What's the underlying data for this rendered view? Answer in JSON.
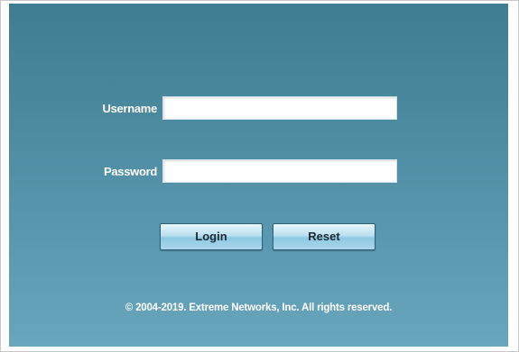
{
  "login_form": {
    "username_label": "Username",
    "username_value": "",
    "password_label": "Password",
    "password_value": "",
    "login_button": "Login",
    "reset_button": "Reset"
  },
  "footer": {
    "copyright": "© 2004-2019. Extreme Networks, Inc. All rights reserved."
  },
  "colors": {
    "panel_top": "#3f7d93",
    "panel_bottom": "#68a6bd",
    "button_gradient_mid": "#8ec8e2"
  }
}
